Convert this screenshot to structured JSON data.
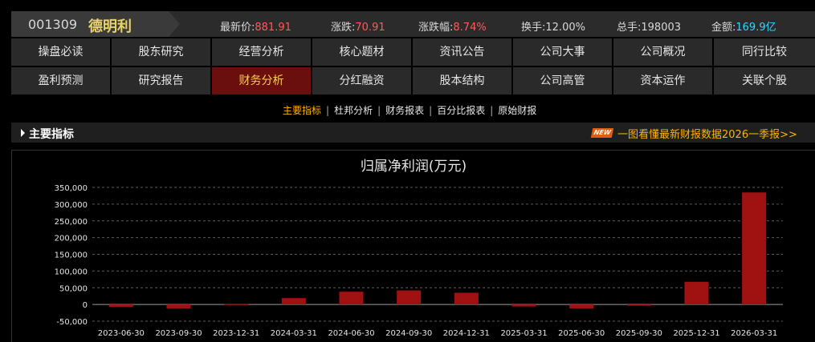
{
  "stock": {
    "code": "001309",
    "name": "德明利"
  },
  "quote": {
    "price_label": "最新价:",
    "price": "881.91",
    "change_label": "涨跌:",
    "change": "70.91",
    "change_pct_label": "涨跌幅:",
    "change_pct": "8.74%",
    "turnover_label": "换手:",
    "turnover": "12.00%",
    "volume_label": "总手:",
    "volume": "198003",
    "amount_label": "金额:",
    "amount": "169.9亿",
    "colors": {
      "up": "#ff5a5a",
      "amount": "#30d8ff"
    }
  },
  "nav": {
    "row1": [
      "操盘必读",
      "股东研究",
      "经营分析",
      "核心题材",
      "资讯公告",
      "公司大事",
      "公司概况",
      "同行比较"
    ],
    "row2": [
      "盈利预测",
      "研究报告",
      "财务分析",
      "分红融资",
      "股本结构",
      "公司高管",
      "资本运作",
      "关联个股"
    ],
    "active": "财务分析"
  },
  "subtabs": {
    "items": [
      "主要指标",
      "杜邦分析",
      "财务报表",
      "百分比报表",
      "原始财报"
    ],
    "active": "主要指标"
  },
  "section": {
    "title": "主要指标",
    "badge": "NEW",
    "promo": "一图看懂最新财报数据2026一季报>>"
  },
  "chart_data": {
    "type": "bar",
    "title": "归属净利润(万元)",
    "categories": [
      "2023-06-30",
      "2023-09-30",
      "2023-12-31",
      "2024-03-31",
      "2024-06-30",
      "2024-09-30",
      "2024-12-31",
      "2025-03-31",
      "2025-06-30",
      "2025-09-30",
      "2025-12-31",
      "2026-03-31"
    ],
    "values": [
      -7000,
      -12000,
      2000,
      19000,
      38000,
      42000,
      35000,
      -6000,
      -12000,
      -2000,
      68000,
      335000
    ],
    "ylim": [
      -50000,
      350000
    ],
    "yticks": [
      350000,
      300000,
      250000,
      200000,
      150000,
      100000,
      50000,
      0,
      -50000
    ],
    "ytick_labels": [
      "350,000",
      "300,000",
      "250,000",
      "200,000",
      "150,000",
      "100,000",
      "50,000",
      "0",
      "-50,000"
    ],
    "grid": true,
    "bar_color": "#a01212"
  }
}
